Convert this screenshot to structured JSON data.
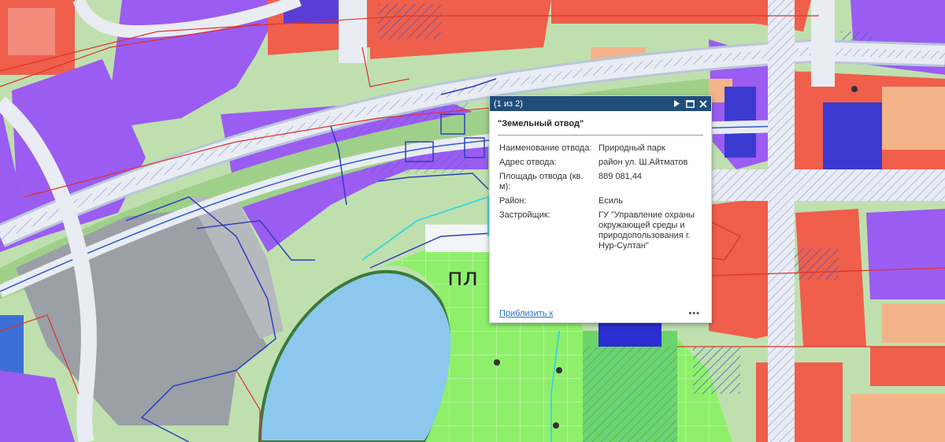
{
  "map": {
    "place_label": "пл",
    "colors": {
      "road": "#e9ecf2",
      "road_border": "#b7c6dc",
      "green_strip": "#9fd08a",
      "purple_zone": "#9b5cf1",
      "red_zone": "#ef5f4b",
      "orange_zone": "#f3b48a",
      "gray_zone": "#9aa0a6",
      "lake": "#8cc8ee",
      "park": "#8ef06a",
      "blue_zone": "#3b3ad0"
    }
  },
  "popup": {
    "pager": "(1 из 2)",
    "title": "\"Земельный отвод\"",
    "fields": [
      {
        "key": "Наименование отвода:",
        "value": "Природный парк"
      },
      {
        "key": "Адрес отвода:",
        "value": "район ул. Ш.Айтматов"
      },
      {
        "key": "Площадь отвода (кв. м):",
        "value": "889 081,44"
      },
      {
        "key": "Район:",
        "value": "Есиль"
      },
      {
        "key": "Застройщик:",
        "value": "ГУ \"Управление охраны окружающей среды и природопользования г. Нур-Султан\""
      }
    ],
    "zoom_link": "Приблизить к",
    "more": "•••"
  }
}
